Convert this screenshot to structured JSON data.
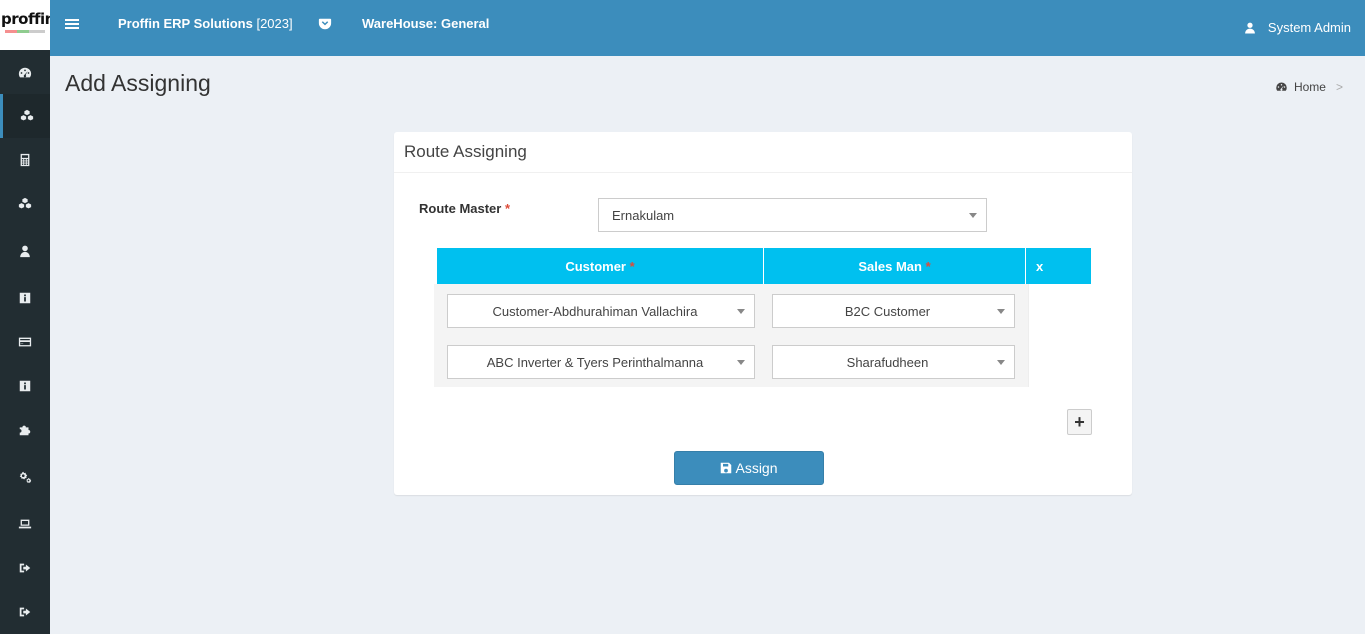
{
  "app": {
    "logo_text": "proffin",
    "brand": "Proffin ERP Solutions",
    "year": "[2023]",
    "warehouse": "WareHouse: General",
    "user": "System Admin",
    "accent": "#3c8dbc"
  },
  "sidebar": {
    "items": [
      {
        "icon": "dashboard-icon"
      },
      {
        "icon": "cubes-icon",
        "active": true
      },
      {
        "icon": "calculator-icon"
      },
      {
        "icon": "cubes-icon"
      },
      {
        "icon": "user-icon"
      },
      {
        "icon": "info-icon"
      },
      {
        "icon": "credit-card-icon"
      },
      {
        "icon": "info-icon"
      },
      {
        "icon": "puzzle-icon"
      },
      {
        "icon": "gears-icon"
      },
      {
        "icon": "laptop-icon"
      },
      {
        "icon": "sign-out-icon"
      },
      {
        "icon": "sign-out-icon"
      }
    ]
  },
  "page": {
    "title": "Add Assigning",
    "breadcrumb_home": "Home",
    "breadcrumb_sep": ">"
  },
  "form": {
    "box_title": "Route Assigning",
    "route_master_label": "Route Master",
    "required_mark": "*",
    "route_master_value": "Ernakulam",
    "columns": {
      "customer": "Customer",
      "sales_man": "Sales Man",
      "x": "x"
    },
    "rows": [
      {
        "customer": "Customer-Abdhurahiman Vallachira",
        "sales_man": "B2C Customer"
      },
      {
        "customer": "ABC Inverter & Tyers Perinthalmanna",
        "sales_man": "Sharafudheen"
      }
    ],
    "add_label": "+",
    "assign_label": "Assign"
  }
}
